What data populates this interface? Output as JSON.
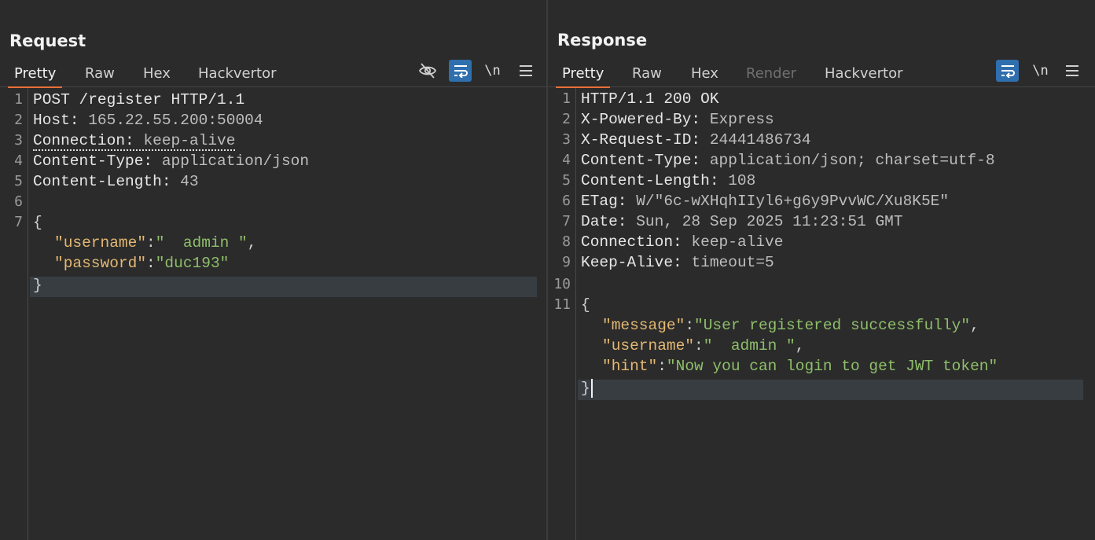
{
  "request": {
    "title": "Request",
    "tabs": [
      {
        "label": "Pretty",
        "active": true
      },
      {
        "label": "Raw"
      },
      {
        "label": "Hex"
      },
      {
        "label": "Hackvertor"
      }
    ],
    "toolbar": {
      "newline_label": "\\n"
    },
    "line_numbers": [
      "1",
      "2",
      "3",
      "4",
      "5",
      "6",
      "7"
    ],
    "lines": [
      {
        "key": "POST /register HTTP/1.1"
      },
      {
        "key": "Host: ",
        "value": "165.22.55.200:50004"
      },
      {
        "key": "Connection: ",
        "value": "keep-alive"
      },
      {
        "key": "Content-Type: ",
        "value": "application/json"
      },
      {
        "key": "Content-Length: ",
        "value": "43"
      },
      {
        "key": ""
      },
      {
        "key": "{"
      }
    ],
    "json": [
      {
        "k": "\"username\"",
        "sep": ":",
        "v": "\"  admin \"",
        "tail": ","
      },
      {
        "k": "\"password\"",
        "sep": ":",
        "v": "\"duc193\"",
        "tail": ""
      }
    ],
    "close_brace": "}"
  },
  "response": {
    "title": "Response",
    "tabs": [
      {
        "label": "Pretty",
        "active": true
      },
      {
        "label": "Raw"
      },
      {
        "label": "Hex"
      },
      {
        "label": "Render",
        "disabled": true
      },
      {
        "label": "Hackvertor"
      }
    ],
    "toolbar": {
      "newline_label": "\\n"
    },
    "line_numbers": [
      "1",
      "2",
      "3",
      "4",
      "5",
      "6",
      "7",
      "8",
      "9",
      "10",
      "11"
    ],
    "lines": [
      {
        "key": "HTTP/1.1 200 OK"
      },
      {
        "key": "X-Powered-By: ",
        "value": "Express"
      },
      {
        "key": "X-Request-ID: ",
        "value": "24441486734"
      },
      {
        "key": "Content-Type: ",
        "value": "application/json; charset=utf-8"
      },
      {
        "key": "Content-Length: ",
        "value": "108"
      },
      {
        "key": "ETag: ",
        "value": "W/\"6c-wXHqhIIyl6+g6y9PvvWC/Xu8K5E\""
      },
      {
        "key": "Date: ",
        "value": "Sun, 28 Sep 2025 11:23:51 GMT"
      },
      {
        "key": "Connection: ",
        "value": "keep-alive"
      },
      {
        "key": "Keep-Alive: ",
        "value": "timeout=5"
      },
      {
        "key": ""
      },
      {
        "key": "{"
      }
    ],
    "json": [
      {
        "k": "\"message\"",
        "sep": ":",
        "v": "\"User registered successfully\"",
        "tail": ","
      },
      {
        "k": "\"username\"",
        "sep": ":",
        "v": "\"  admin \"",
        "tail": ","
      },
      {
        "k": "\"hint\"",
        "sep": ":",
        "v": "\"Now you can login to get JWT token\"",
        "tail": ""
      }
    ],
    "close_brace": "}"
  }
}
